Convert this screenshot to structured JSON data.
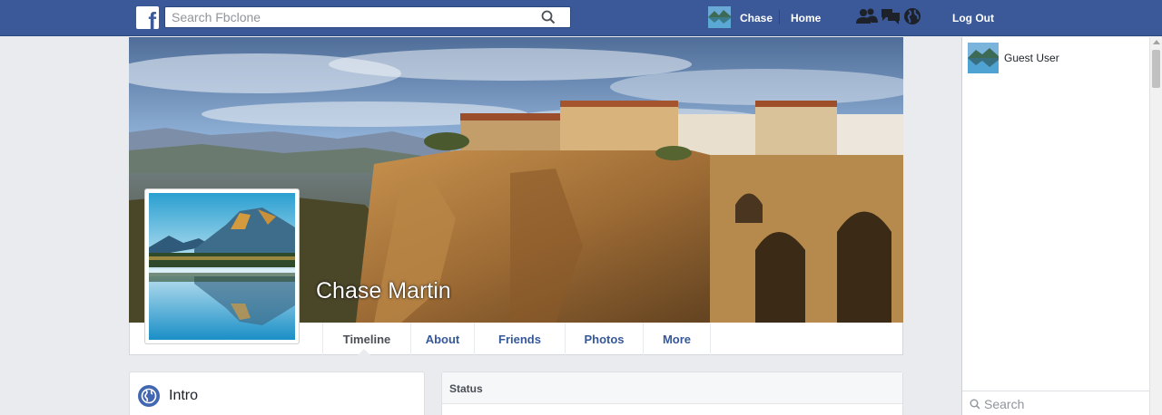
{
  "topbar": {
    "logo_letter": "f",
    "search_placeholder": "Search Fbclone",
    "user_name": "Chase",
    "home_label": "Home",
    "logout_label": "Log Out",
    "icons": [
      "friend-requests-icon",
      "messages-icon",
      "notifications-globe-icon"
    ],
    "bg_color": "#3b5998"
  },
  "profile": {
    "name": "Chase Martin"
  },
  "tabs": [
    {
      "label": "Timeline",
      "active": true
    },
    {
      "label": "About",
      "active": false
    },
    {
      "label": "Friends",
      "active": false
    },
    {
      "label": "Photos",
      "active": false
    },
    {
      "label": "More",
      "active": false
    }
  ],
  "intro": {
    "title": "Intro"
  },
  "status": {
    "title": "Status"
  },
  "chat": {
    "users": [
      {
        "name": "Guest User"
      }
    ],
    "search_placeholder": "Search"
  }
}
